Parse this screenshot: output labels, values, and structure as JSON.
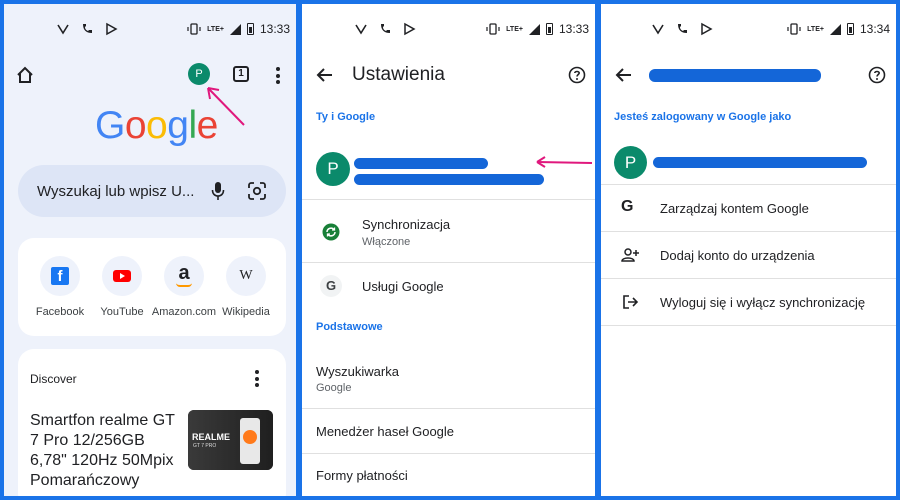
{
  "status": {
    "panel1_time": "13:33",
    "panel2_time": "13:33",
    "panel3_time": "13:34",
    "network": "LTE+"
  },
  "chrome_home": {
    "avatar_letter": "P",
    "tab_count": "1",
    "logo_letters": [
      {
        "ch": "G",
        "color": "#4285f4"
      },
      {
        "ch": "o",
        "color": "#ea4335"
      },
      {
        "ch": "o",
        "color": "#fbbc05"
      },
      {
        "ch": "g",
        "color": "#4285f4"
      },
      {
        "ch": "l",
        "color": "#34a853"
      },
      {
        "ch": "e",
        "color": "#ea4335"
      }
    ],
    "search_placeholder": "Wyszukaj lub wpisz U...",
    "shortcuts": [
      {
        "label": "Facebook",
        "icon": "facebook-icon"
      },
      {
        "label": "YouTube",
        "icon": "youtube-icon"
      },
      {
        "label": "Amazon.com",
        "icon": "amazon-icon"
      },
      {
        "label": "Wikipedia",
        "icon": "wikipedia-icon"
      }
    ],
    "discover_title": "Discover",
    "article_title": "Smartfon realme GT 7 Pro 12/256GB 6,78\" 120Hz 50Mpix Pomarańczowy",
    "thumbnail_text": "REALME",
    "thumbnail_subtext": "GT 7 PRO"
  },
  "settings": {
    "title": "Ustawienia",
    "section_you_google": "Ty i Google",
    "account_avatar_letter": "P",
    "sync_title": "Synchronizacja",
    "sync_status": "Włączone",
    "google_services": "Usługi Google",
    "section_basic": "Podstawowe",
    "search_engine_title": "Wyszukiwarka",
    "search_engine_value": "Google",
    "password_manager": "Menedżer haseł Google",
    "payment_methods": "Formy płatności"
  },
  "account": {
    "signed_in_header": "Jesteś zalogowany w Google jako",
    "avatar_letter": "P",
    "manage_account": "Zarządzaj kontem Google",
    "add_account": "Dodaj konto do urządzenia",
    "sign_out": "Wyloguj się i wyłącz synchronizację"
  },
  "colors": {
    "frame": "#1a73e8",
    "accent": "#1a73e8",
    "avatar": "#0b8a6b",
    "annotation_arrow": "#e0187d",
    "redaction": "#1466d8"
  }
}
